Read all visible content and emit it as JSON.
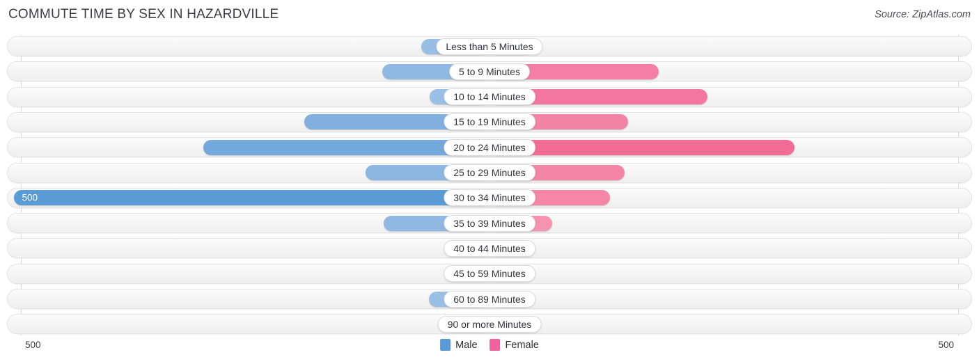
{
  "header": {
    "title": "COMMUTE TIME BY SEX IN HAZARDVILLE",
    "source": "Source: ZipAtlas.com"
  },
  "legend": {
    "male_label": "Male",
    "female_label": "Female",
    "male_color": "#5B9BD5",
    "female_color": "#F0629B"
  },
  "axis": {
    "left_label": "500",
    "right_label": "500",
    "max": 500
  },
  "chart_data": {
    "type": "bar",
    "subtype": "diverging-bidirectional",
    "title": "COMMUTE TIME BY SEX IN HAZARDVILLE",
    "xlabel": "",
    "ylabel": "",
    "xlim": [
      -500,
      500
    ],
    "grid": true,
    "legend_position": "bottom-center",
    "categories": [
      "Less than 5 Minutes",
      "5 to 9 Minutes",
      "10 to 14 Minutes",
      "15 to 19 Minutes",
      "20 to 24 Minutes",
      "25 to 29 Minutes",
      "30 to 34 Minutes",
      "35 to 39 Minutes",
      "40 to 44 Minutes",
      "45 to 59 Minutes",
      "60 to 89 Minutes",
      "90 or more Minutes"
    ],
    "series": [
      {
        "name": "Male",
        "direction": "left",
        "color": "#5B9BD5",
        "values": [
          72,
          113,
          63,
          195,
          301,
          130,
          500,
          111,
          8,
          47,
          64,
          47
        ]
      },
      {
        "name": "Female",
        "direction": "right",
        "color": "#F0629B",
        "values": [
          36,
          178,
          229,
          146,
          321,
          142,
          127,
          66,
          0,
          43,
          29,
          8
        ]
      }
    ]
  }
}
